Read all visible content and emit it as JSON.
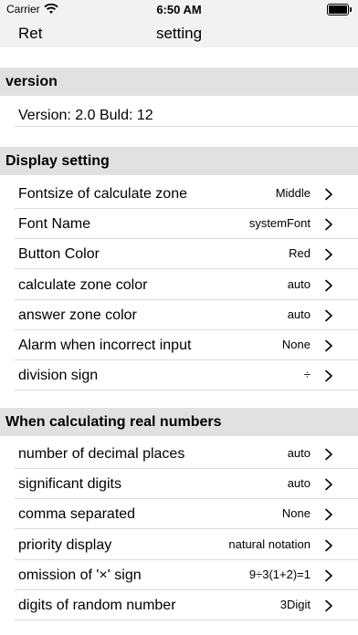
{
  "status": {
    "carrier": "Carrier",
    "time": "6:50 AM",
    "battery_level": 1.0
  },
  "nav": {
    "back_label": "Ret",
    "title": "setting"
  },
  "version_section": {
    "header": "version",
    "text": "Version: 2.0  Buld: 12"
  },
  "display_section": {
    "header": "Display setting",
    "rows": [
      {
        "label": "Fontsize of calculate zone",
        "value": "Middle"
      },
      {
        "label": "Font Name",
        "value": "systemFont"
      },
      {
        "label": "Button Color",
        "value": "Red"
      },
      {
        "label": "calculate zone color",
        "value": "auto"
      },
      {
        "label": "answer zone color",
        "value": "auto"
      },
      {
        "label": "Alarm when incorrect input",
        "value": "None"
      },
      {
        "label": "division sign",
        "value": "÷"
      }
    ]
  },
  "real_section": {
    "header": "When calculating real numbers",
    "rows": [
      {
        "label": "number of decimal places",
        "value": "auto"
      },
      {
        "label": "significant digits",
        "value": "auto"
      },
      {
        "label": "comma separated",
        "value": "None"
      },
      {
        "label": "priority display",
        "value": "natural notation"
      },
      {
        "label": "omission of '×' sign",
        "value": "9÷3(1+2)=1"
      },
      {
        "label": "digits of random number",
        "value": "3Digit"
      }
    ]
  }
}
